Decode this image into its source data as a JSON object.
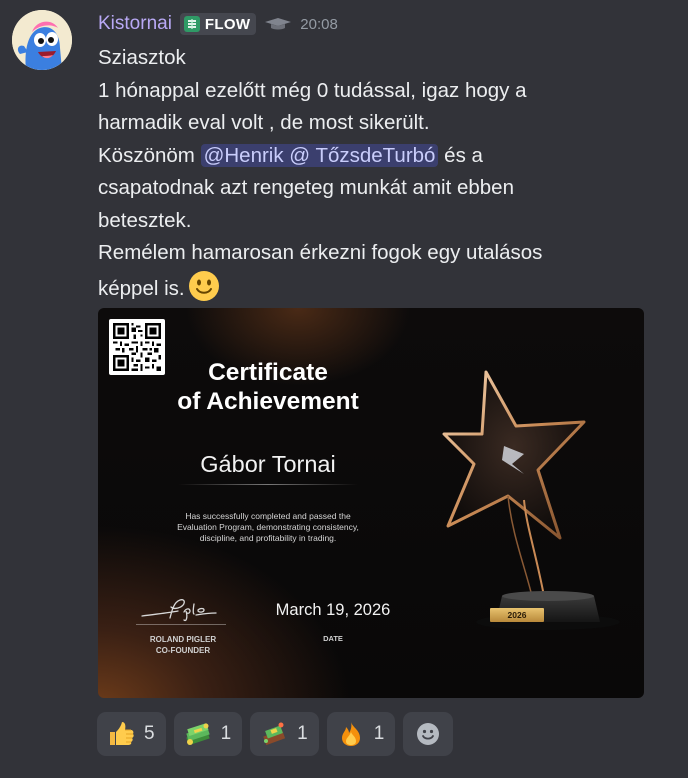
{
  "message": {
    "username": "Kistornai",
    "tag_label": "FLOW",
    "timestamp": "20:08",
    "lines": [
      "Sziasztok",
      "1 hónappal ezelőtt még 0 tudással, igaz hogy a",
      "harmadik eval volt , de most sikerült.",
      "Köszönöm",
      "@Henrik @ TőzsdeTurbó",
      "és a",
      "csapatodnak azt rengeteg munkát amit ebben",
      "betesztek.",
      "Remélem hamarosan érkezni fogok egy utalásos",
      "képpel is."
    ]
  },
  "certificate": {
    "title_line1": "Certificate",
    "title_line2": "of Achievement",
    "recipient": "Gábor Tornai",
    "description_line1": "Has successfully completed and passed the",
    "description_line2": "Evaluation Program, demonstrating consistency,",
    "description_line3": "discipline, and profitability in trading.",
    "date": "March 19, 2026",
    "date_label": "DATE",
    "founder_name": "ROLAND PIGLER",
    "founder_title": "CO-FOUNDER",
    "trophy_year": "2026"
  },
  "reactions": [
    {
      "emoji": "thumbs-up-icon",
      "count": "5"
    },
    {
      "emoji": "money-stack-icon",
      "count": "1"
    },
    {
      "emoji": "money-bag-icon",
      "count": "1"
    },
    {
      "emoji": "fire-icon",
      "count": "1"
    }
  ],
  "colors": {
    "background": "#323339",
    "username": "#b9a9f5",
    "mention_bg": "#3b3f6e",
    "mention_text": "#c9cdfb",
    "reaction_bg": "#404249"
  }
}
